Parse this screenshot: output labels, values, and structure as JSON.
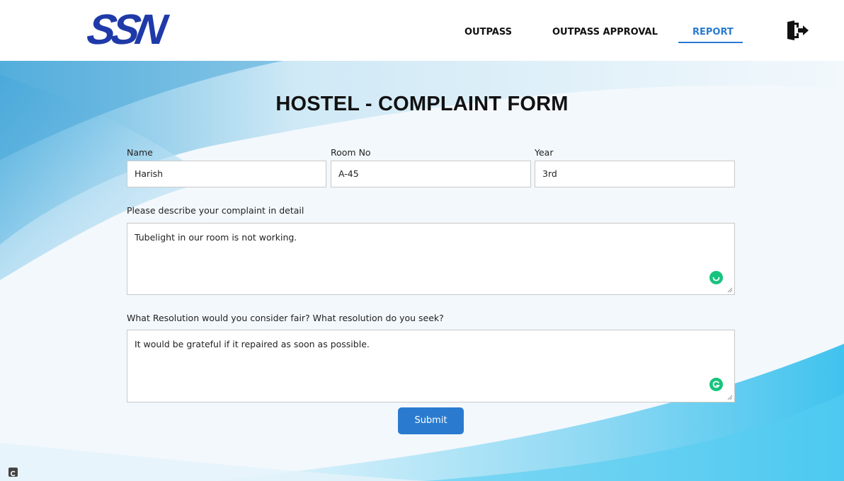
{
  "header": {
    "logo_text": "SSN",
    "nav": {
      "outpass": "OUTPASS",
      "outpass_approval": "OUTPASS APPROVAL",
      "report": "REPORT"
    },
    "active_nav": "REPORT",
    "logout_icon": "logout-door-icon"
  },
  "form": {
    "title": "HOSTEL - COMPLAINT FORM",
    "name": {
      "label": "Name",
      "value": "Harish"
    },
    "room": {
      "label": "Room No",
      "value": "A-45"
    },
    "year": {
      "label": "Year",
      "value": "3rd"
    },
    "complaint": {
      "label": "Please describe your complaint in detail",
      "value": "Tubelight in our room is not working."
    },
    "resolution": {
      "label": "What Resolution would you consider fair? What resolution do you seek?",
      "value": "It would be grateful if it repaired as soon as possible."
    },
    "submit_label": "Submit"
  },
  "colors": {
    "accent": "#2a7bd0",
    "logo": "#1f3aa8",
    "grammarly": "#16c47e"
  }
}
